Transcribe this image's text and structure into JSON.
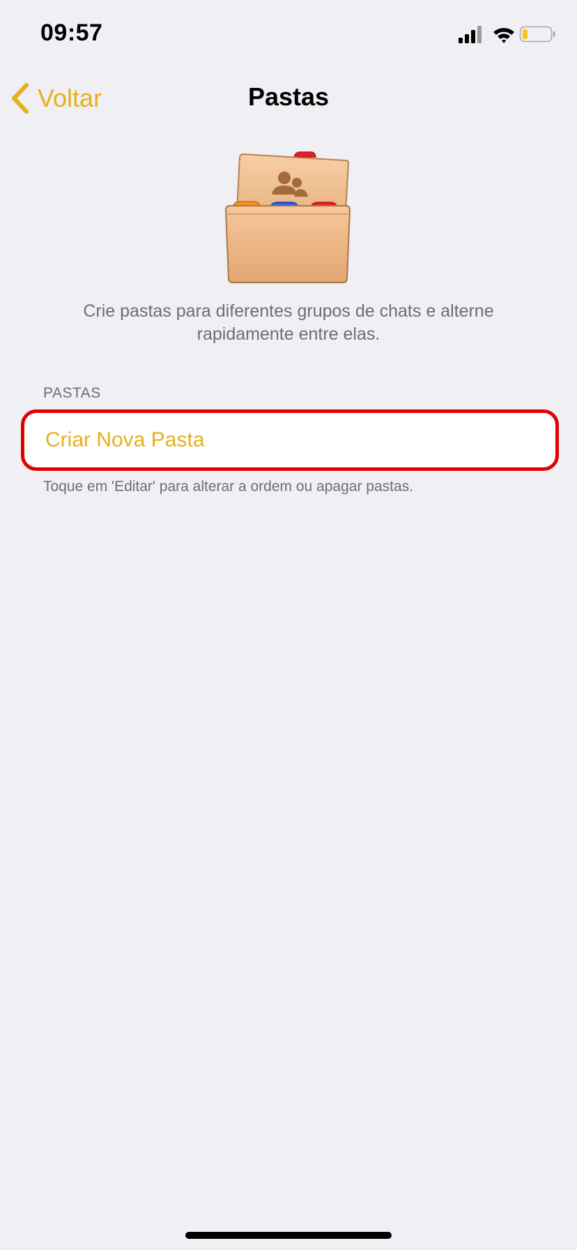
{
  "status_bar": {
    "time": "09:57",
    "icons": [
      "cellular-signal-icon",
      "wifi-icon",
      "battery-icon"
    ],
    "battery_color": "#f5c518"
  },
  "nav": {
    "back_label": "Voltar",
    "title": "Pastas"
  },
  "intro": {
    "illustration_icon": "folders-illustration-icon",
    "description": "Crie pastas para diferentes grupos de chats e alterne rapidamente entre elas."
  },
  "folders_section": {
    "header": "PASTAS",
    "create_label": "Criar Nova Pasta",
    "footer": "Toque em 'Editar' para alterar a ordem ou apagar pastas."
  },
  "colors": {
    "accent": "#e6b01b",
    "background": "#efeff4",
    "highlight_border": "#e00000",
    "secondary_text": "#6d6d72"
  }
}
